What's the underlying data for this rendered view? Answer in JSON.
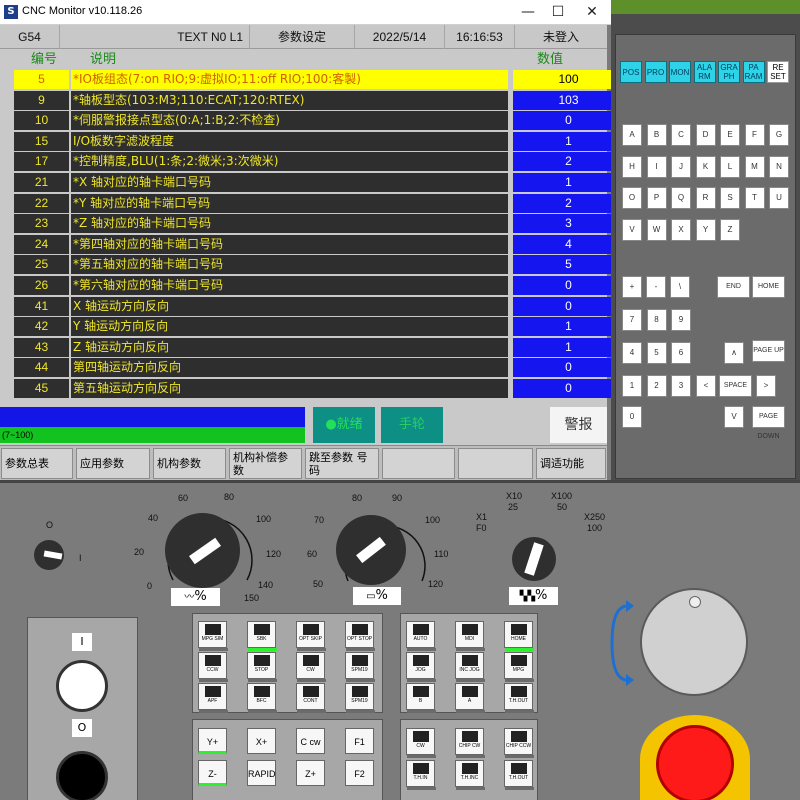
{
  "window": {
    "title": "CNC Monitor v10.118.26",
    "icon": "app-logo-icon",
    "controls": {
      "minimize": "—",
      "maximize": "☐",
      "close": "✕"
    }
  },
  "header": {
    "coord": "G54",
    "program": "TEXT N0 L1",
    "mode": "参数设定",
    "date": "2022/5/14",
    "time": "16:16:53",
    "login": "未登入"
  },
  "columns": {
    "number": "编号",
    "description": "说明",
    "value": "数值"
  },
  "params": [
    {
      "num": "5",
      "desc": "*IO板组态(7:on RIO;9:虚拟IO;11:off RIO;100:客製)",
      "val": "100",
      "selected": true
    },
    {
      "num": "9",
      "desc": "*轴板型态(103:M3;110:ECAT;120:RTEX)",
      "val": "103"
    },
    {
      "num": "10",
      "desc": "*伺服警报接点型态(0:A;1:B;2:不检查)",
      "val": "0"
    },
    {
      "num": "15",
      "desc": "I/O板数字滤波程度",
      "val": "1"
    },
    {
      "num": "17",
      "desc": "*控制精度,BLU(1:条;2:微米;3:次微米)",
      "val": "2"
    },
    {
      "num": "21",
      "desc": "*X 轴对应的轴卡端口号码",
      "val": "1"
    },
    {
      "num": "22",
      "desc": "*Y 轴对应的轴卡端口号码",
      "val": "2"
    },
    {
      "num": "23",
      "desc": "*Z 轴对应的轴卡端口号码",
      "val": "3"
    },
    {
      "num": "24",
      "desc": "*第四轴对应的轴卡端口号码",
      "val": "4"
    },
    {
      "num": "25",
      "desc": "*第五轴对应的轴卡端口号码",
      "val": "5"
    },
    {
      "num": "26",
      "desc": "*第六轴对应的轴卡端口号码",
      "val": "0"
    },
    {
      "num": "41",
      "desc": "X 轴运动方向反向",
      "val": "0"
    },
    {
      "num": "42",
      "desc": "Y 轴运动方向反向",
      "val": "1"
    },
    {
      "num": "43",
      "desc": "Z 轴运动方向反向",
      "val": "1"
    },
    {
      "num": "44",
      "desc": "第四轴运动方向反向",
      "val": "0"
    },
    {
      "num": "45",
      "desc": "第五轴运动方向反向",
      "val": "0"
    }
  ],
  "status": {
    "progress_label": "(7~100)",
    "ready": "●就绪",
    "handwheel": "手轮",
    "alarm": "警报"
  },
  "softkeys": [
    "参数总表",
    "应用参数",
    "机构参数",
    "机构补偿参数",
    "跳至参数 号码",
    "调适功能"
  ],
  "mode_keys": [
    "POS",
    "PRO",
    "MON",
    "ALA RM",
    "GRA PH",
    "PA RAM",
    "RE SET"
  ],
  "letter_keys": [
    "A",
    "B",
    "C",
    "D",
    "E",
    "F",
    "G",
    "H",
    "I",
    "J",
    "K",
    "L",
    "M",
    "N",
    "O",
    "P",
    "Q",
    "R",
    "S",
    "T",
    "U",
    "V",
    "W",
    "X",
    "Y",
    "Z"
  ],
  "nav_keys": {
    "plus": "+",
    "minus": "-",
    "backslash": "\\",
    "end": "END",
    "home": "HOME",
    "up": "∧",
    "page_up": "PAGE UP",
    "left": "<",
    "space": "SPACE",
    "right": ">",
    "down": "V",
    "page_down": "PAGE DOWN"
  },
  "digit_keys": [
    "7",
    "8",
    "9",
    "4",
    "5",
    "6",
    "1",
    "2",
    "3",
    "0"
  ],
  "machine": {
    "switch_labels": [
      "O",
      "I"
    ],
    "feed_dial": {
      "ticks": [
        "0",
        "20",
        "40",
        "60",
        "80",
        "100",
        "120",
        "140",
        "150"
      ],
      "unit": "%"
    },
    "spindle_dial": {
      "ticks": [
        "50",
        "60",
        "70",
        "80",
        "90",
        "100",
        "110",
        "120"
      ],
      "unit": "%"
    },
    "jog_dial": {
      "ticks": [
        "X1",
        "F0",
        "X10",
        "25",
        "X100",
        "50",
        "X250",
        "100"
      ],
      "unit": "%"
    },
    "left_keys": [
      "MPG SIM",
      "SBK",
      "OPT SKIP",
      "OPT STOP",
      "CCW",
      "STOP",
      "CW",
      "SPM19",
      "APF",
      "BFC",
      "CONT",
      "SPM19"
    ],
    "left_active": [
      "SBK"
    ],
    "mode_keys": [
      "AUTO",
      "MDI",
      "HOME",
      "JOG",
      "INC JOG",
      "MPG",
      "B",
      "A",
      "T.H.OUT"
    ],
    "mode_active": [
      "HOME"
    ],
    "axis_keys": [
      "Y+",
      "X+",
      "C cw",
      "F1",
      "Z-",
      "RAPID",
      "Z+",
      "F2"
    ],
    "tool_keys": [
      "CW",
      "CHIP CW",
      "CHIP CCW",
      "T.H.IN",
      "T.H.INC",
      "T.H.OUT"
    ],
    "power_on": "I",
    "power_off": "O"
  },
  "colors": {
    "selected_row": "#ffff00",
    "row_bg": "#2e2e2e",
    "row_text": "#f0e72a",
    "value_bg": "#1515f0",
    "accent_cyan": "#2fd3e8",
    "ready_green": "#22e05a",
    "estop_red": "#ff1a1a"
  }
}
